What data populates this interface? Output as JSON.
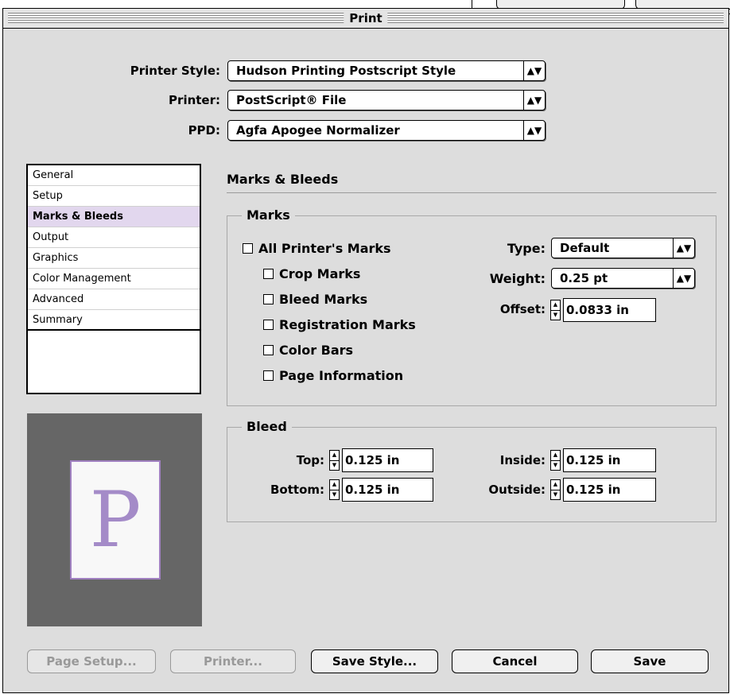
{
  "window": {
    "title": "Print"
  },
  "header": {
    "printer_style_label": "Printer Style:",
    "printer_style_value": "Hudson Printing Postscript Style",
    "printer_label": "Printer:",
    "printer_value": "PostScript® File",
    "ppd_label": "PPD:",
    "ppd_value": "Agfa Apogee Normalizer"
  },
  "sidebar": {
    "items": [
      {
        "label": "General"
      },
      {
        "label": "Setup"
      },
      {
        "label": "Marks & Bleeds"
      },
      {
        "label": "Output"
      },
      {
        "label": "Graphics"
      },
      {
        "label": "Color Management"
      },
      {
        "label": "Advanced"
      },
      {
        "label": "Summary"
      }
    ],
    "selected": "Marks & Bleeds"
  },
  "preview": {
    "letter": "P"
  },
  "main": {
    "section_title": "Marks & Bleeds",
    "marks": {
      "title": "Marks",
      "all_printers_marks": "All Printer's Marks",
      "crop_marks": "Crop Marks",
      "bleed_marks": "Bleed Marks",
      "registration_marks": "Registration Marks",
      "color_bars": "Color Bars",
      "page_information": "Page Information",
      "type_label": "Type:",
      "type_value": "Default",
      "weight_label": "Weight:",
      "weight_value": "0.25 pt",
      "offset_label": "Offset:",
      "offset_value": "0.0833 in"
    },
    "bleed": {
      "title": "Bleed",
      "top_label": "Top:",
      "top_value": "0.125 in",
      "bottom_label": "Bottom:",
      "bottom_value": "0.125 in",
      "inside_label": "Inside:",
      "inside_value": "0.125 in",
      "outside_label": "Outside:",
      "outside_value": "0.125 in"
    }
  },
  "footer": {
    "page_setup": "Page Setup...",
    "printer": "Printer...",
    "save_style": "Save Style...",
    "cancel": "Cancel",
    "save": "Save"
  }
}
